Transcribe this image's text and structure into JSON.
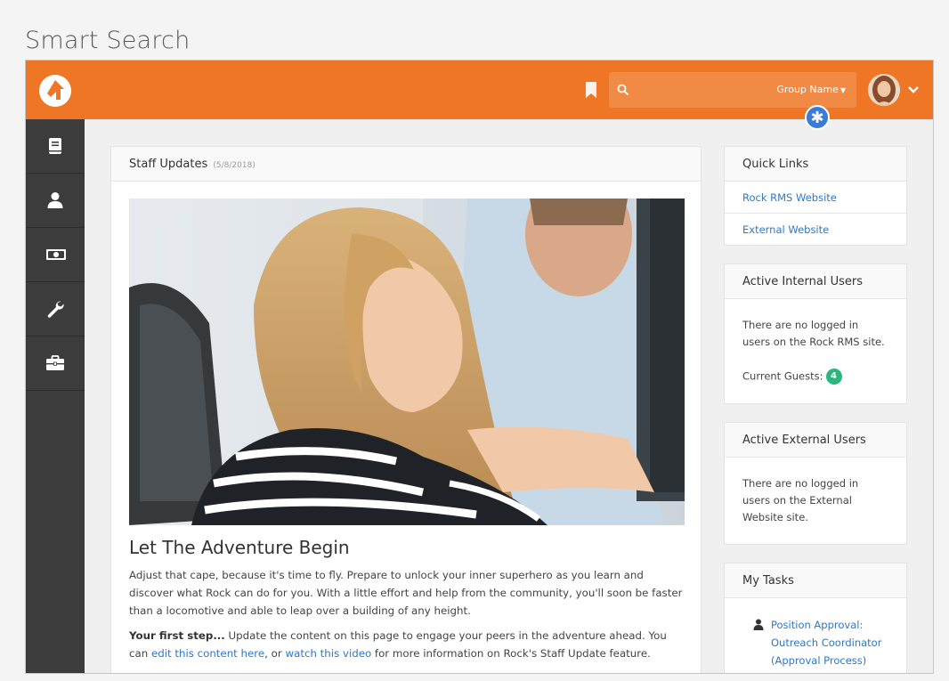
{
  "page": {
    "heading": "Smart Search"
  },
  "topbar": {
    "search": {
      "placeholder": "",
      "filter_label": "Group Name",
      "badge": "✱"
    }
  },
  "icons": {
    "logo": "rock-logo-icon",
    "bookmark": "bookmark-icon",
    "search": "search-icon",
    "user_caret": "chevron-down-icon",
    "sidebar": [
      "book-icon",
      "person-icon",
      "money-icon",
      "wrench-icon",
      "briefcase-icon"
    ]
  },
  "colors": {
    "brand": "#ee7625",
    "sidebar": "#3c3c3c",
    "link": "#2f78c4",
    "badge": "#2cb67d",
    "smart_badge": "#3a7bd5"
  },
  "staff": {
    "title": "Staff Updates",
    "date": "(5/8/2018)",
    "article_title": "Let The Adventure Begin",
    "para1": "Adjust that cape, because it's time to fly. Prepare to unlock your inner superhero as you learn and discover what Rock can do for you. With a little effort and help from the community, you'll soon be faster than a locomotive and able to leap over a building of any height.",
    "p2_bold": "Your first step...",
    "p2_text1": " Update the content on this page to engage your peers in the adventure ahead. You can ",
    "p2_link1": "edit this content here",
    "p2_text2": ", or ",
    "p2_link2": "watch this video",
    "p2_text3": " for more information on Rock's Staff Update feature."
  },
  "quick_links": {
    "title": "Quick Links",
    "links": [
      "Rock RMS Website",
      "External Website"
    ]
  },
  "internal_users": {
    "title": "Active Internal Users",
    "message": "There are no logged in users on the Rock RMS site.",
    "guests_label": "Current Guests:",
    "guests_count": "4"
  },
  "external_users": {
    "title": "Active External Users",
    "message": "There are no logged in users on the External Website site."
  },
  "tasks": {
    "title": "My Tasks",
    "items": [
      "Position Approval: Outreach Coordinator (Approval Process)"
    ]
  }
}
